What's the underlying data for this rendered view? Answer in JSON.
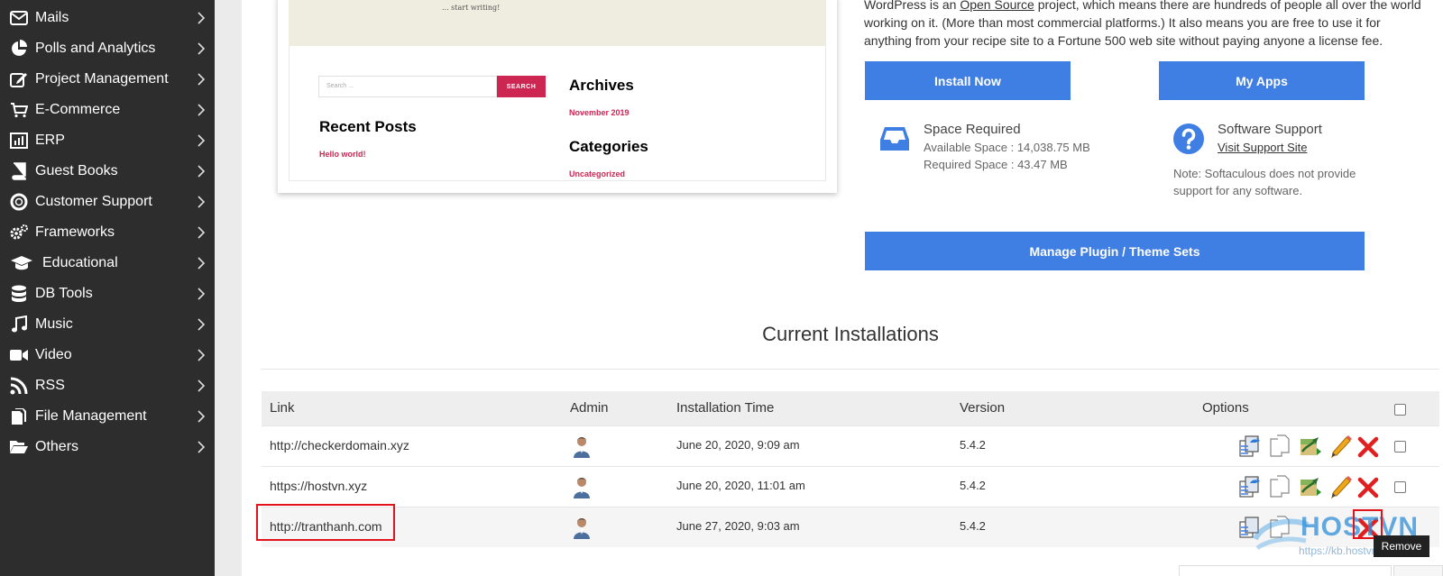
{
  "sidebar": {
    "items": [
      {
        "label": "Mails",
        "icon": "envelope-icon"
      },
      {
        "label": "Polls and Analytics",
        "icon": "pie-chart-icon"
      },
      {
        "label": "Project Management",
        "icon": "edit-icon"
      },
      {
        "label": "E-Commerce",
        "icon": "cart-icon"
      },
      {
        "label": "ERP",
        "icon": "bar-chart-icon"
      },
      {
        "label": "Guest Books",
        "icon": "book-icon"
      },
      {
        "label": "Customer Support",
        "icon": "lifebuoy-icon"
      },
      {
        "label": "Frameworks",
        "icon": "gears-icon"
      },
      {
        "label": "Educational",
        "icon": "graduation-cap-icon"
      },
      {
        "label": "DB Tools",
        "icon": "database-icon"
      },
      {
        "label": "Music",
        "icon": "music-note-icon"
      },
      {
        "label": "Video",
        "icon": "video-camera-icon"
      },
      {
        "label": "RSS",
        "icon": "rss-icon"
      },
      {
        "label": "File Management",
        "icon": "file-icon"
      },
      {
        "label": "Others",
        "icon": "folder-open-icon"
      }
    ]
  },
  "preview": {
    "intro_text": "... start writing!",
    "search_placeholder": "Search ...",
    "search_button": "SEARCH",
    "archives_heading": "Archives",
    "archives_link": "November 2019",
    "recent_heading": "Recent Posts",
    "recent_link": "Hello world!",
    "categories_heading": "Categories",
    "categories_link": "Uncategorized"
  },
  "description": {
    "line1_a": "WordPress is an ",
    "line1_link": "Open Source",
    "line1_b": " project, which means there are hundreds of people all over the world",
    "line2": "working on it. (More than most commercial platforms.) It also means you are free to use it for",
    "line3": "anything from your recipe site to a Fortune 500 web site without paying anyone a license fee."
  },
  "buttons": {
    "install": "Install Now",
    "my_apps": "My Apps",
    "manage_sets": "Manage Plugin / Theme Sets"
  },
  "space": {
    "title": "Space Required",
    "available": "Available Space : 14,038.75 MB",
    "required": "Required Space : 43.47 MB"
  },
  "support": {
    "title": "Software Support",
    "link": "Visit Support Site",
    "note1": "Note: Softaculous does not provide",
    "note2": "support for any software."
  },
  "installations": {
    "title": "Current Installations",
    "headers": {
      "link": "Link",
      "admin": "Admin",
      "time": "Installation Time",
      "version": "Version",
      "options": "Options"
    },
    "rows": [
      {
        "link": "http://checkerdomain.xyz",
        "time": "June 20, 2020, 9:09 am",
        "version": "5.4.2"
      },
      {
        "link": "https://hostvn.xyz",
        "time": "June 20, 2020, 11:01 am",
        "version": "5.4.2"
      },
      {
        "link": "http://tranthanh.com",
        "time": "June 27, 2020, 9:03 am",
        "version": "5.4.2"
      }
    ]
  },
  "tooltip": "Remove",
  "watermark": {
    "brand": "HOSTVN",
    "url": "https://kb.hostvn.net"
  },
  "colors": {
    "sidebar_bg": "#2d2d2d",
    "button_blue": "#3f7ee2",
    "highlight_red": "#e1141b",
    "wp_accent": "#cd2653"
  }
}
